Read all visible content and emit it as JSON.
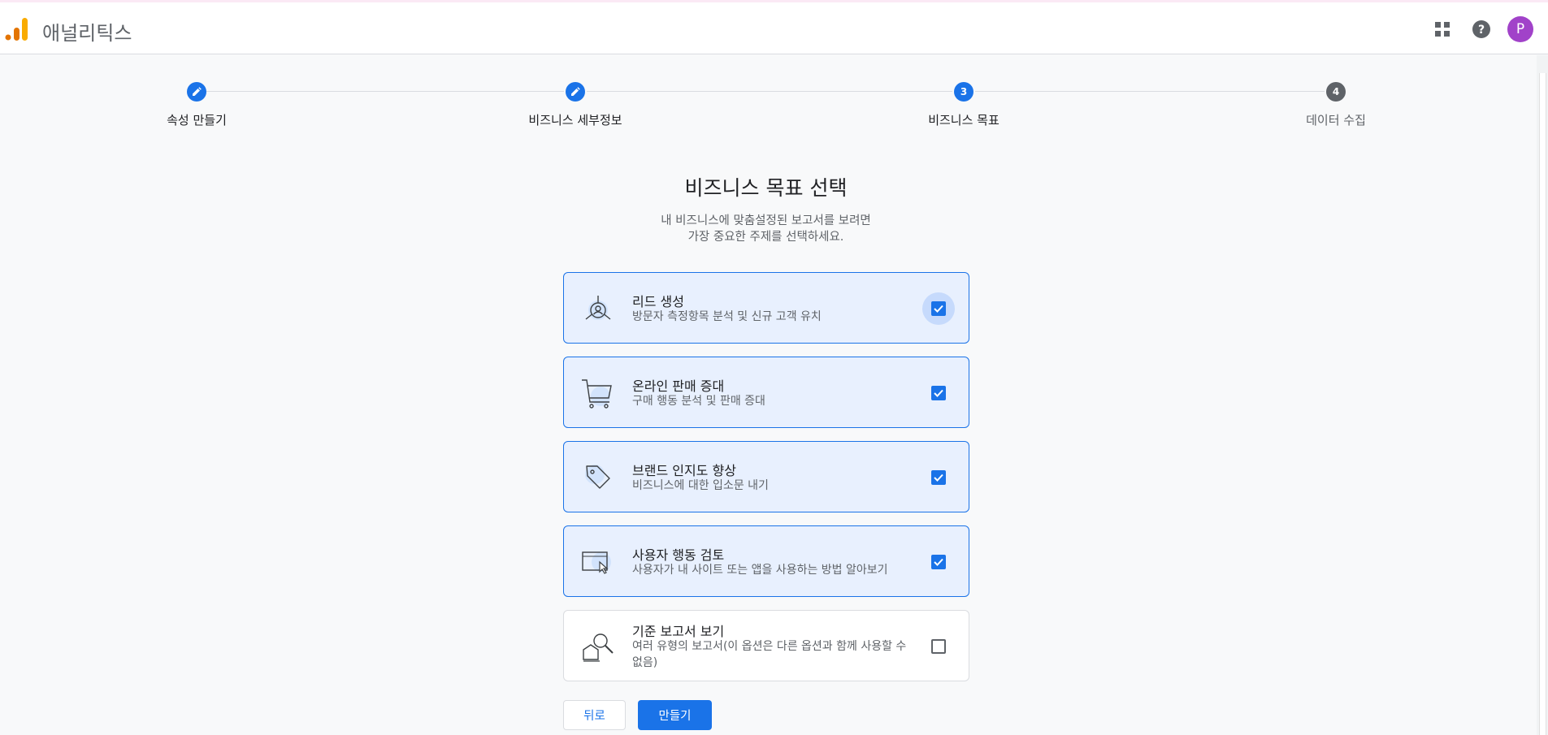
{
  "header": {
    "app_title": "애널리틱스",
    "avatar_letter": "P",
    "brand_colors": {
      "logo_orange": "#f9ab00",
      "logo_dark_orange": "#e37400"
    }
  },
  "stepper": {
    "steps": [
      {
        "label": "속성 만들기",
        "state": "completed",
        "icon": "pencil-icon"
      },
      {
        "label": "비즈니스 세부정보",
        "state": "completed",
        "icon": "pencil-icon"
      },
      {
        "label": "비즈니스 목표",
        "state": "current",
        "number": "3"
      },
      {
        "label": "데이터 수집",
        "state": "upcoming",
        "number": "4"
      }
    ]
  },
  "main": {
    "title": "비즈니스 목표 선택",
    "subtitle_line1": "내 비즈니스에 맞춤설정된 보고서를 보려면",
    "subtitle_line2": "가장 중요한 주제를 선택하세요."
  },
  "options": [
    {
      "title": "리드 생성",
      "description": "방문자 측정항목 분석 및 신규 고객 유치",
      "checked": true,
      "icon": "lead-target-icon"
    },
    {
      "title": "온라인 판매 증대",
      "description": "구매 행동 분석 및 판매 증대",
      "checked": true,
      "icon": "shopping-cart-icon"
    },
    {
      "title": "브랜드 인지도 향상",
      "description": "비즈니스에 대한 입소문 내기",
      "checked": true,
      "icon": "tag-icon"
    },
    {
      "title": "사용자 행동 검토",
      "description": "사용자가 내 사이트 또는 앱을 사용하는 방법 알아보기",
      "checked": true,
      "icon": "cursor-window-icon"
    },
    {
      "title": "기준 보고서 보기",
      "description": "여러 유형의 보고서(이 옵션은 다른 옵션과 함께 사용할 수 없음)",
      "checked": false,
      "icon": "magnifier-report-icon"
    }
  ],
  "actions": {
    "back_label": "뒤로",
    "create_label": "만들기"
  },
  "colors": {
    "accent": "#1a73e8",
    "selected_card_bg": "#e8f0fe",
    "avatar_bg": "#a142c9"
  }
}
